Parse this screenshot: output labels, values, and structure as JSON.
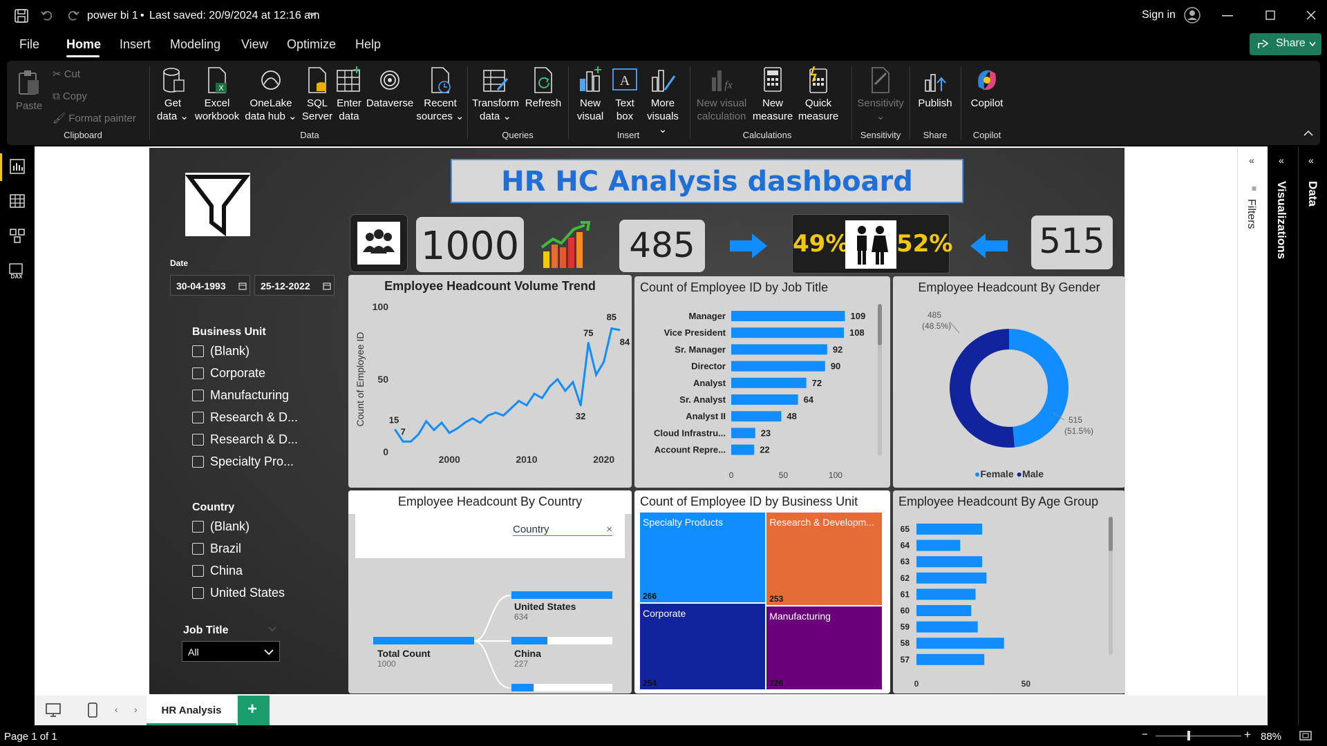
{
  "titlebar": {
    "doc_title": "power bi 1",
    "saved": "Last saved: 20/9/2024 at 12:16 am",
    "sign_in": "Sign in"
  },
  "menu": {
    "file": "File",
    "home": "Home",
    "insert": "Insert",
    "modeling": "Modeling",
    "view": "View",
    "optimize": "Optimize",
    "help": "Help",
    "share": "Share"
  },
  "ribbon": {
    "paste": "Paste",
    "cut": "Cut",
    "copy": "Copy",
    "format_painter": "Format painter",
    "clipboard": "Clipboard",
    "get_data_1": "Get",
    "get_data_2": "data",
    "excel_1": "Excel",
    "excel_2": "workbook",
    "onelake_1": "OneLake",
    "onelake_2": "data hub",
    "sql_1": "SQL",
    "sql_2": "Server",
    "enter_1": "Enter",
    "enter_2": "data",
    "dataverse": "Dataverse",
    "recent_1": "Recent",
    "recent_2": "sources",
    "data_group": "Data",
    "transform_1": "Transform",
    "transform_2": "data",
    "refresh": "Refresh",
    "queries_group": "Queries",
    "newvisual_1": "New",
    "newvisual_2": "visual",
    "textbox_1": "Text",
    "textbox_2": "box",
    "more_1": "More",
    "more_2": "visuals",
    "insert_group": "Insert",
    "newcalc_1": "New visual",
    "newcalc_2": "calculation",
    "newmeasure_1": "New",
    "newmeasure_2": "measure",
    "quick_1": "Quick",
    "quick_2": "measure",
    "calc_group": "Calculations",
    "sensitivity": "Sensitivity",
    "sensitivity_group": "Sensitivity",
    "publish": "Publish",
    "share_group": "Share",
    "copilot": "Copilot",
    "copilot_group": "Copilot"
  },
  "dashboard": {
    "title": "HR HC Analysis dashboard",
    "kpi_total": "1000",
    "kpi_female": "485",
    "pct_female": "49%",
    "pct_male": "52%",
    "kpi_male": "515"
  },
  "slicers": {
    "date_label": "Date",
    "date_from": "30-04-1993",
    "date_to": "25-12-2022",
    "bu_label": "Business Unit",
    "bu_items": [
      "(Blank)",
      "Corporate",
      "Manufacturing",
      "Research & D...",
      "Research & D...",
      "Specialty Pro..."
    ],
    "country_label": "Country",
    "country_items": [
      "(Blank)",
      "Brazil",
      "China",
      "United States"
    ],
    "job_label": "Job Title",
    "job_value": "All"
  },
  "trend": {
    "title": "Employee Headcount Volume Trend",
    "ylabel": "Count of Employee ID"
  },
  "jobtitle": {
    "title": "Count of Employee ID by Job Title"
  },
  "gender": {
    "title": "Employee Headcount By Gender",
    "legend_female": "Female",
    "legend_male": "Male"
  },
  "country": {
    "title": "Employee Headcount By Country",
    "field": "Country",
    "total_label": "Total Count",
    "total_value": "1000",
    "us_label": "United States",
    "us_value": "634",
    "china_label": "China",
    "china_value": "227"
  },
  "bu": {
    "title": "Count of Employee ID by Business Unit"
  },
  "age": {
    "title": "Employee Headcount By Age Group"
  },
  "panes": {
    "filters": "Filters",
    "visualizations": "Visualizations",
    "data": "Data"
  },
  "tabs": {
    "page1": "HR Analysis"
  },
  "status": {
    "page": "Page 1 of 1",
    "zoom": "88%"
  },
  "colors": {
    "accent": "#118dff",
    "dark_blue": "#12239e",
    "orange": "#e66c37",
    "purple": "#6b007b",
    "title_blue": "#1f6fd6",
    "kpi_yellow": "#f2c80f"
  },
  "chart_data": [
    {
      "type": "line",
      "title": "Employee Headcount Volume Trend",
      "ylabel": "Count of Employee ID",
      "xlabel": "",
      "ylim": [
        0,
        100
      ],
      "yticks": [
        0,
        50,
        100
      ],
      "xticks": [
        2000,
        2010,
        2020
      ],
      "x": [
        1993,
        1994,
        1995,
        1996,
        1997,
        1998,
        1999,
        2000,
        2001,
        2002,
        2003,
        2004,
        2005,
        2006,
        2007,
        2008,
        2009,
        2010,
        2011,
        2012,
        2013,
        2014,
        2015,
        2016,
        2017,
        2018,
        2019,
        2020,
        2021,
        2022
      ],
      "values": [
        15,
        7,
        7,
        12,
        21,
        15,
        20,
        13,
        16,
        20,
        23,
        20,
        25,
        27,
        25,
        30,
        35,
        32,
        40,
        37,
        45,
        50,
        42,
        48,
        32,
        75,
        53,
        62,
        85,
        84
      ],
      "data_labels": [
        {
          "x": 1993,
          "y": 15
        },
        {
          "x": 1994,
          "y": 7
        },
        {
          "x": 2017,
          "y": 32
        },
        {
          "x": 2018,
          "y": 75
        },
        {
          "x": 2021,
          "y": 85
        },
        {
          "x": 2022,
          "y": 84
        }
      ]
    },
    {
      "type": "bar",
      "orientation": "horizontal",
      "title": "Count of Employee ID by Job Title",
      "categories": [
        "Manager",
        "Vice President",
        "Sr. Manager",
        "Director",
        "Analyst",
        "Sr. Analyst",
        "Analyst II",
        "Cloud Infrastru...",
        "Account Repre..."
      ],
      "values": [
        109,
        108,
        92,
        90,
        72,
        64,
        48,
        23,
        22
      ],
      "xticks": [
        0,
        50,
        100
      ],
      "xlim": [
        0,
        110
      ]
    },
    {
      "type": "pie",
      "title": "Employee Headcount By Gender",
      "donut": true,
      "categories": [
        "Female",
        "Male"
      ],
      "values": [
        485,
        515
      ],
      "percent_labels": [
        "(48.5%)",
        "(51.5%)"
      ],
      "colors": [
        "#118dff",
        "#12239e"
      ],
      "legend": "bottom"
    },
    {
      "type": "bar",
      "orientation": "horizontal",
      "title": "Employee Headcount By Age Group",
      "categories": [
        "65",
        "64",
        "63",
        "62",
        "61",
        "60",
        "59",
        "58",
        "57"
      ],
      "values": [
        30,
        20,
        30,
        32,
        27,
        25,
        28,
        40,
        31
      ],
      "xticks": [
        0,
        50
      ],
      "xlim": [
        0,
        60
      ]
    },
    {
      "type": "treemap",
      "title": "Count of Employee ID by Business Unit",
      "categories": [
        "Specialty Products",
        "Research & Developm...",
        "Corporate",
        "Manufacturing"
      ],
      "values": [
        266,
        253,
        254,
        226
      ],
      "colors": [
        "#118dff",
        "#e66c37",
        "#12239e",
        "#6b007b"
      ]
    }
  ]
}
